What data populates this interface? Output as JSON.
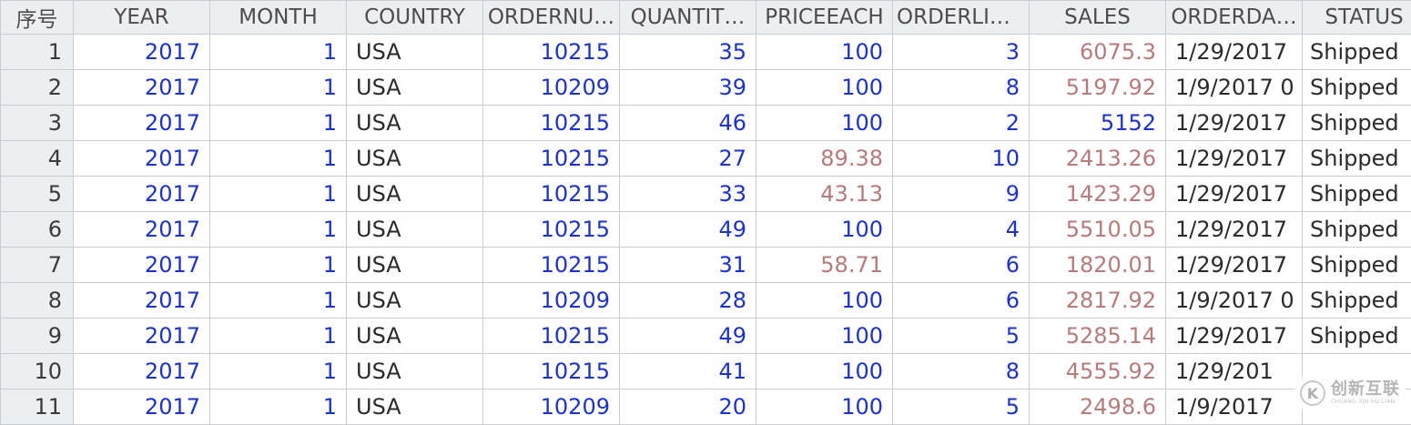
{
  "colors": {
    "header_bg": "#eceef1",
    "grid_line": "#c8cdd4",
    "number_blue": "#1d33c8",
    "number_highlight": "#b67b7b",
    "text": "#2b2b2b"
  },
  "headers": [
    "序号",
    "YEAR",
    "MONTH",
    "COUNTRY",
    "ORDERNU…",
    "QUANTIT…",
    "PRICEEACH",
    "ORDERLIN…",
    "SALES",
    "ORDERDA…",
    "STATUS"
  ],
  "rows": [
    {
      "idx": "1",
      "year": "2017",
      "month": "1",
      "country": "USA",
      "ordernum": "10215",
      "quantity": "35",
      "price": "100",
      "orderline": "3",
      "sales": "6075.3",
      "orderdate": "1/29/2017",
      "status": "Shipped",
      "price_hl": false,
      "sales_hl": true
    },
    {
      "idx": "2",
      "year": "2017",
      "month": "1",
      "country": "USA",
      "ordernum": "10209",
      "quantity": "39",
      "price": "100",
      "orderline": "8",
      "sales": "5197.92",
      "orderdate": "1/9/2017 0",
      "status": "Shipped",
      "price_hl": false,
      "sales_hl": true
    },
    {
      "idx": "3",
      "year": "2017",
      "month": "1",
      "country": "USA",
      "ordernum": "10215",
      "quantity": "46",
      "price": "100",
      "orderline": "2",
      "sales": "5152",
      "orderdate": "1/29/2017",
      "status": "Shipped",
      "price_hl": false,
      "sales_hl": false
    },
    {
      "idx": "4",
      "year": "2017",
      "month": "1",
      "country": "USA",
      "ordernum": "10215",
      "quantity": "27",
      "price": "89.38",
      "orderline": "10",
      "sales": "2413.26",
      "orderdate": "1/29/2017",
      "status": "Shipped",
      "price_hl": true,
      "sales_hl": true
    },
    {
      "idx": "5",
      "year": "2017",
      "month": "1",
      "country": "USA",
      "ordernum": "10215",
      "quantity": "33",
      "price": "43.13",
      "orderline": "9",
      "sales": "1423.29",
      "orderdate": "1/29/2017",
      "status": "Shipped",
      "price_hl": true,
      "sales_hl": true
    },
    {
      "idx": "6",
      "year": "2017",
      "month": "1",
      "country": "USA",
      "ordernum": "10215",
      "quantity": "49",
      "price": "100",
      "orderline": "4",
      "sales": "5510.05",
      "orderdate": "1/29/2017",
      "status": "Shipped",
      "price_hl": false,
      "sales_hl": true
    },
    {
      "idx": "7",
      "year": "2017",
      "month": "1",
      "country": "USA",
      "ordernum": "10215",
      "quantity": "31",
      "price": "58.71",
      "orderline": "6",
      "sales": "1820.01",
      "orderdate": "1/29/2017",
      "status": "Shipped",
      "price_hl": true,
      "sales_hl": true
    },
    {
      "idx": "8",
      "year": "2017",
      "month": "1",
      "country": "USA",
      "ordernum": "10209",
      "quantity": "28",
      "price": "100",
      "orderline": "6",
      "sales": "2817.92",
      "orderdate": "1/9/2017 0",
      "status": "Shipped",
      "price_hl": false,
      "sales_hl": true
    },
    {
      "idx": "9",
      "year": "2017",
      "month": "1",
      "country": "USA",
      "ordernum": "10215",
      "quantity": "49",
      "price": "100",
      "orderline": "5",
      "sales": "5285.14",
      "orderdate": "1/29/2017",
      "status": "Shipped",
      "price_hl": false,
      "sales_hl": true
    },
    {
      "idx": "10",
      "year": "2017",
      "month": "1",
      "country": "USA",
      "ordernum": "10215",
      "quantity": "41",
      "price": "100",
      "orderline": "8",
      "sales": "4555.92",
      "orderdate": "1/29/201",
      "status": "",
      "price_hl": false,
      "sales_hl": true
    },
    {
      "idx": "11",
      "year": "2017",
      "month": "1",
      "country": "USA",
      "ordernum": "10209",
      "quantity": "20",
      "price": "100",
      "orderline": "5",
      "sales": "2498.6",
      "orderdate": "1/9/2017",
      "status": "",
      "price_hl": false,
      "sales_hl": true
    }
  ],
  "watermark": {
    "logo_glyph": "K",
    "main": "创新互联",
    "sub": "CHUANG XIN HU LIAN"
  }
}
